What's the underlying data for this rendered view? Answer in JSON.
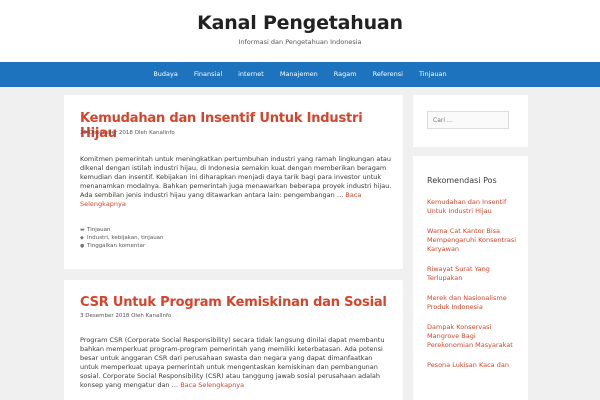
{
  "site": {
    "title": "Kanal Pengetahuan",
    "description": "Informasi dan Pengetahuan Indonesia"
  },
  "nav": {
    "items": [
      "Budaya",
      "Finansial",
      "internet",
      "Manajemen",
      "Ragam",
      "Referensi",
      "Tinjauan"
    ]
  },
  "articles": [
    {
      "title": "Kemudahan dan Insentif Untuk Industri Hijau",
      "meta": "20 Desember 2018 Oleh KanalInfo",
      "body": "Komitmen pemerintah untuk meningkatkan pertumbuhan industri yang ramah lingkungan atau dikenal dengan istilah industri hijau, di Indonesia semakin kuat dengan memberikan beragam kemudian dan insentif. Kebijakan ini diharapkan menjadi daya tarik bagi para investor untuk menanamkan modalnya. Bahkan pemerintah juga menawarkan beberapa proyek industri hijau. Ada sembilan jenis industri hijau yang ditawarkan antara lain: pengembangan …",
      "more": "Baca Selengkapnya",
      "category": "Tinjauan",
      "tags": "Industri, kebijakan, tinjauan",
      "comment": "Tinggalkan komentar"
    },
    {
      "title": "CSR Untuk Program Kemiskinan dan Sosial",
      "meta": "3 Desember 2018 Oleh KanalInfo",
      "body": "Program CSR (Corporate Social Responsibility) secara tidak langsung dinilai dapat membantu bahkan memperkuat program-program pemerintah yang memiliki keterbatasan. Ada potensi besar untuk anggaran CSR dari perusahaan swasta dan negara yang dapat dimanfaatkan untuk memperkuat upaya pemerintah untuk mengentaskan kemiskinan dan pembangunan sosial. Corporate Social Responsibility (CSR) atau tanggung jawab sosial perusahaan adalah konsep yang mengatur dan …",
      "more": "Baca Selengkapnya"
    }
  ],
  "sidebar": {
    "search_placeholder": "Cari …",
    "recommend_title": "Rekomendasi Pos",
    "recommend_items": [
      "Kemudahan dan Insentif Untuk Industri Hijau",
      "Warna Cat Kantor Bisa Mempengaruhi Konsentrasi Karyawan",
      "Riwayat Surat Yang Terlupakan",
      "Merek dan Nasionalisme Produk Indonesia",
      "Dampak Konservasi Mangrove Bagi Perekonomian Masyarakat",
      "Pesona Lukisan Kaca dan"
    ]
  },
  "colors": {
    "accent": "#d6442b",
    "nav_bg": "#1e73be",
    "page_bg": "#f0f0f0"
  }
}
